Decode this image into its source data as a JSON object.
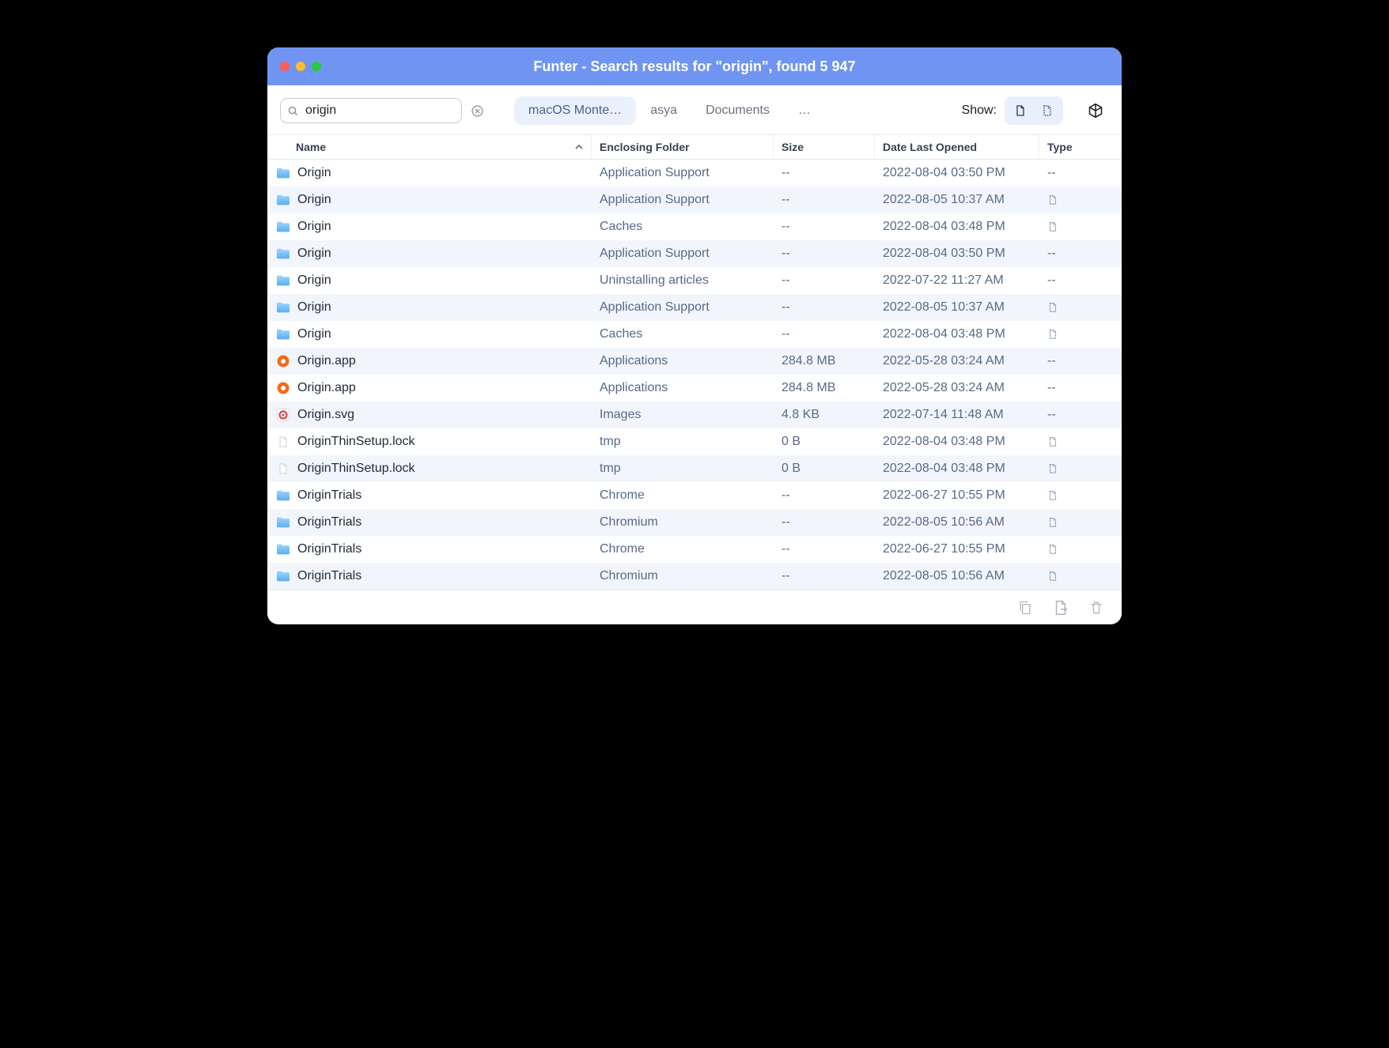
{
  "window": {
    "title": "Funter - Search results for \"origin\", found 5 947"
  },
  "search": {
    "value": "origin",
    "placeholder": "Search"
  },
  "scopes": [
    {
      "label": "macOS Monte…",
      "active": true
    },
    {
      "label": "asya",
      "active": false
    },
    {
      "label": "Documents",
      "active": false
    },
    {
      "label": "…",
      "active": false
    }
  ],
  "show_label": "Show:",
  "columns": {
    "name": "Name",
    "folder": "Enclosing Folder",
    "size": "Size",
    "date": "Date Last Opened",
    "type": "Type"
  },
  "rows": [
    {
      "icon": "folder",
      "name": "Origin",
      "folder": "Application Support",
      "size": "--",
      "date": "2022-08-04 03:50 PM",
      "type": "--"
    },
    {
      "icon": "folder",
      "name": "Origin",
      "folder": "Application Support",
      "size": "--",
      "date": "2022-08-05 10:37 AM",
      "type": "hidden"
    },
    {
      "icon": "folder",
      "name": "Origin",
      "folder": "Caches",
      "size": "--",
      "date": "2022-08-04 03:48 PM",
      "type": "hidden"
    },
    {
      "icon": "folder",
      "name": "Origin",
      "folder": "Application Support",
      "size": "--",
      "date": "2022-08-04 03:50 PM",
      "type": "--"
    },
    {
      "icon": "folder",
      "name": "Origin",
      "folder": "Uninstalling articles",
      "size": "--",
      "date": "2022-07-22 11:27 AM",
      "type": "--"
    },
    {
      "icon": "folder",
      "name": "Origin",
      "folder": "Application Support",
      "size": "--",
      "date": "2022-08-05 10:37 AM",
      "type": "hidden"
    },
    {
      "icon": "folder",
      "name": "Origin",
      "folder": "Caches",
      "size": "--",
      "date": "2022-08-04 03:48 PM",
      "type": "hidden"
    },
    {
      "icon": "app",
      "name": "Origin.app",
      "folder": "Applications",
      "size": "284.8 MB",
      "date": "2022-05-28 03:24 AM",
      "type": "--"
    },
    {
      "icon": "app",
      "name": "Origin.app",
      "folder": "Applications",
      "size": "284.8 MB",
      "date": "2022-05-28 03:24 AM",
      "type": "--"
    },
    {
      "icon": "svg",
      "name": "Origin.svg",
      "folder": "Images",
      "size": "4.8 KB",
      "date": "2022-07-14 11:48 AM",
      "type": "--"
    },
    {
      "icon": "file",
      "name": "OriginThinSetup.lock",
      "folder": "tmp",
      "size": "0 B",
      "date": "2022-08-04 03:48 PM",
      "type": "hidden"
    },
    {
      "icon": "file",
      "name": "OriginThinSetup.lock",
      "folder": "tmp",
      "size": "0 B",
      "date": "2022-08-04 03:48 PM",
      "type": "hidden"
    },
    {
      "icon": "folder",
      "name": "OriginTrials",
      "folder": "Chrome",
      "size": "--",
      "date": "2022-06-27 10:55 PM",
      "type": "hidden"
    },
    {
      "icon": "folder",
      "name": "OriginTrials",
      "folder": "Chromium",
      "size": "--",
      "date": "2022-08-05 10:56 AM",
      "type": "hidden"
    },
    {
      "icon": "folder",
      "name": "OriginTrials",
      "folder": "Chrome",
      "size": "--",
      "date": "2022-06-27 10:55 PM",
      "type": "hidden"
    },
    {
      "icon": "folder",
      "name": "OriginTrials",
      "folder": "Chromium",
      "size": "--",
      "date": "2022-08-05 10:56 AM",
      "type": "hidden"
    }
  ]
}
